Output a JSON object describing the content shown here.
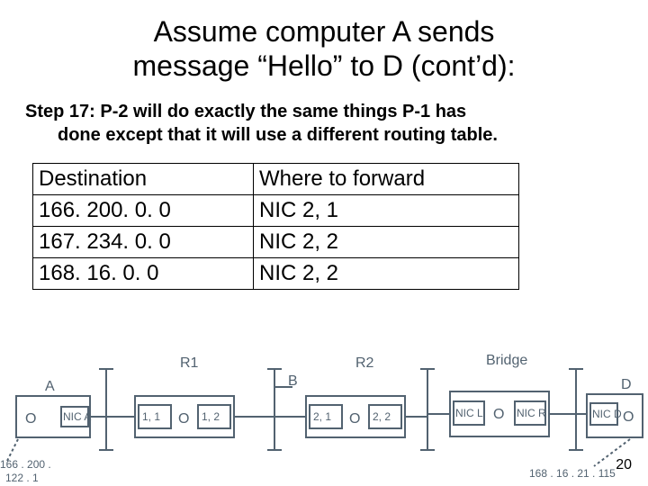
{
  "title_line1": "Assume computer A sends",
  "title_line2": "message “Hello” to D (cont’d):",
  "step_lead": "Step 17: P-2 will do exactly the same things P-1 has",
  "step_cont": "done except that it will use a different routing table.",
  "routing_table": {
    "headers": {
      "dest": "Destination",
      "fwd": "Where to forward"
    },
    "rows": [
      {
        "dest": "166. 200. 0. 0",
        "fwd": "NIC 2, 1"
      },
      {
        "dest": "167. 234. 0. 0",
        "fwd": "NIC 2, 2"
      },
      {
        "dest": "168. 16. 0. 0",
        "fwd": "NIC 2, 2"
      }
    ]
  },
  "diagram": {
    "labels": {
      "A": "A",
      "R1": "R1",
      "B": "B",
      "R2": "R2",
      "Bridge": "Bridge",
      "D": "D",
      "nicA": "NIC A",
      "r1_left": "1, 1",
      "r1_right": "1, 2",
      "r2_left": "2, 1",
      "r2_right": "2, 2",
      "nicL": "NIC L",
      "nicR": "NIC R",
      "nicD": "NIC D",
      "oA": "O",
      "oR1L": "O",
      "oR2R": "O",
      "oBL": "O",
      "oD": "O",
      "ip_left1": "166 . 200 .",
      "ip_left2": "122 . 1",
      "ip_right": "168 . 16 . 21 . 115"
    }
  },
  "page_number": "20"
}
